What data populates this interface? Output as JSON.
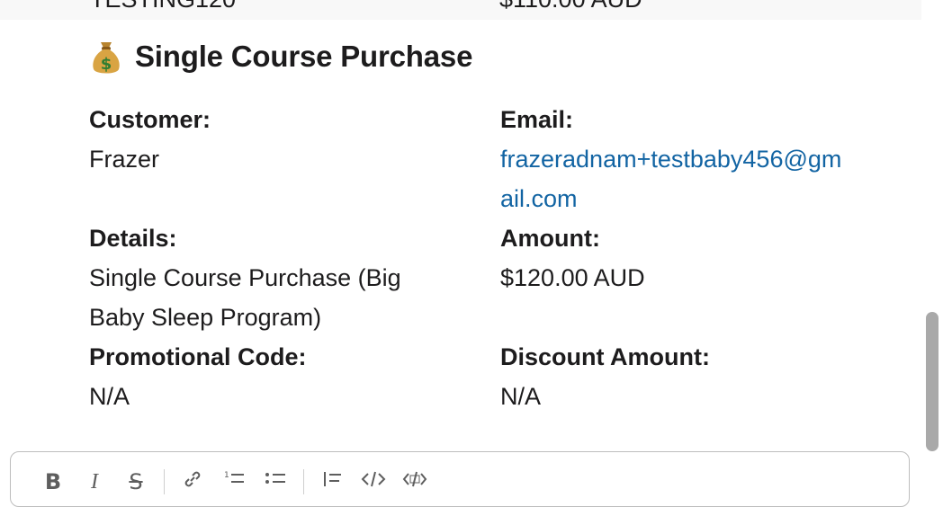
{
  "previous_row": {
    "left_text": "TESTING120",
    "right_text": "$110.00 AUD"
  },
  "card": {
    "emoji": "money-bag",
    "title": "Single Course Purchase",
    "customer_label": "Customer:",
    "customer_value": "Frazer",
    "email_label": "Email:",
    "email_line1": "frazeradnam+testbaby456@gm",
    "email_line2": "ail.com",
    "details_label": "Details:",
    "details_line1": "Single Course Purchase (Big",
    "details_line2": "Baby Sleep Program)",
    "amount_label": "Amount:",
    "amount_value": "$120.00 AUD",
    "promo_label": "Promotional Code:",
    "promo_value": "N/A",
    "discount_label": "Discount Amount:",
    "discount_value": "N/A"
  },
  "composer_toolbar": {
    "bold": "B",
    "italic": "I",
    "strike": "S",
    "link_icon": "link-icon",
    "ordered_list_icon": "ordered-list-icon",
    "bullet_list_icon": "bullet-list-icon",
    "blockquote_icon": "blockquote-icon",
    "code_icon": "code-icon",
    "code_block_icon": "code-block-icon"
  },
  "colors": {
    "link": "#1264a3",
    "text": "#1d1c1d",
    "scrollbar": "#a9a9a9"
  }
}
